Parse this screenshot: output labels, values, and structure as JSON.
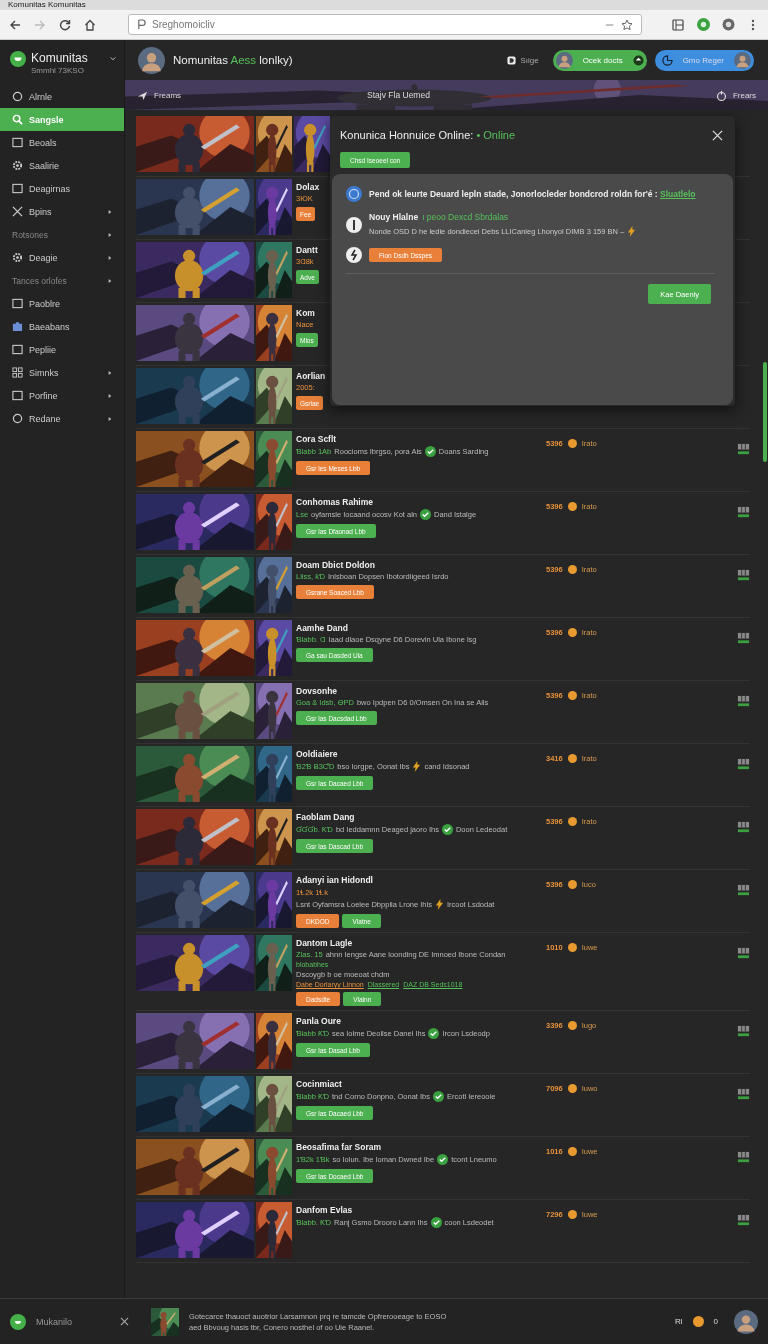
{
  "browser": {
    "tab_title": "Komunitas Komunitas",
    "url": "Sreghomoicliv"
  },
  "sidebar": {
    "brand": "Komunitas",
    "subtitle": "Smmhl 73KSO",
    "items": [
      {
        "kind": "item",
        "label": "Alrnle",
        "selected": false,
        "submenu": false
      },
      {
        "kind": "item",
        "label": "Sangsle",
        "selected": true,
        "submenu": false
      },
      {
        "kind": "item",
        "label": "Beoals",
        "selected": false,
        "submenu": false
      },
      {
        "kind": "item",
        "label": "Saalirie",
        "selected": false,
        "submenu": false
      },
      {
        "kind": "item",
        "label": "Deagirnas",
        "selected": false,
        "submenu": false
      },
      {
        "kind": "item",
        "label": "Bpins",
        "selected": false,
        "submenu": true
      },
      {
        "kind": "section",
        "label": "Rotsones",
        "submenu": true
      },
      {
        "kind": "item",
        "label": "Deagie",
        "selected": false,
        "submenu": true
      },
      {
        "kind": "section",
        "label": "Tances orlofes",
        "submenu": true
      },
      {
        "kind": "item",
        "label": "Paoblre",
        "selected": false,
        "submenu": false
      },
      {
        "kind": "item",
        "label": "Baeabans",
        "selected": false,
        "submenu": false
      },
      {
        "kind": "item",
        "label": "Pepliie",
        "selected": false,
        "submenu": false
      },
      {
        "kind": "item",
        "label": "Simnks",
        "selected": false,
        "submenu": true
      },
      {
        "kind": "item",
        "label": "Porfine",
        "selected": false,
        "submenu": true
      },
      {
        "kind": "item",
        "label": "Redane",
        "selected": false,
        "submenu": true
      }
    ]
  },
  "header": {
    "title": "Nomunitas",
    "tag": "Aess",
    "suffix": "lonlky)",
    "link": "Sıige",
    "pill_primary": "Ocek docts",
    "pill_secondary": "Gmo Reger"
  },
  "hero": {
    "left": "Freams",
    "center": "Stajv Fla Uemed",
    "right": "Frears"
  },
  "rows": [
    {
      "buttons": []
    },
    {
      "title": "Dolax",
      "lines": [
        {
          "kind": "lead",
          "text": "3ЮK"
        }
      ],
      "buttons": [
        {
          "label": "Fee",
          "kind": "orange"
        }
      ]
    },
    {
      "title": "Dantt",
      "lines": [
        {
          "kind": "lead",
          "text": "3Ɑ8k"
        }
      ],
      "buttons": [
        {
          "label": "Adve",
          "kind": "green"
        }
      ]
    },
    {
      "title": "Kom",
      "lines": [
        {
          "kind": "lead",
          "text": "Nace"
        }
      ],
      "buttons": [
        {
          "label": "Mlos",
          "kind": "green"
        }
      ]
    },
    {
      "title": "Aorlian",
      "lines": [
        {
          "kind": "lead",
          "text": "2005:"
        }
      ],
      "buttons": [
        {
          "label": "Gsrlae",
          "kind": "orange"
        }
      ]
    },
    {
      "title": "Cora Scflt",
      "lines": [
        {
          "kind": "meta",
          "lead": "Ɓlabb 1Ab",
          "text": "Roocioms Ibrgso, pora Ais",
          "verified": true,
          "tail": "Doans Sarding"
        }
      ],
      "buttons": [
        {
          "label": "Gsr les Meses Lbb",
          "kind": "orange"
        }
      ],
      "price": "5396",
      "coin": "Irato"
    },
    {
      "title": "Conhomas Rahime",
      "lines": [
        {
          "kind": "meta",
          "lead": "Lse",
          "text": "oyfamsle Iocaand ocosv Kot aln",
          "verified": true,
          "tail": "Dand Istalge"
        }
      ],
      "buttons": [
        {
          "label": "Gsr las Dfaonad Lbb",
          "kind": "green"
        }
      ],
      "price": "5396",
      "coin": "Irato"
    },
    {
      "title": "Doam Dbict Doldon",
      "lines": [
        {
          "kind": "meta",
          "lead": "Liiss, ƙƊ",
          "text": "Inlsboan Dopsen Ibotordiigeed Isrdo"
        }
      ],
      "buttons": [
        {
          "label": "Gsrane Soaced Lbb",
          "kind": "orange"
        }
      ],
      "price": "5396",
      "coin": "Irato"
    },
    {
      "title": "Aamhe Dand",
      "lines": [
        {
          "kind": "meta",
          "lead": "Ɓlabb. Ɑ",
          "text": "Iaad dlaoe Dsqyne D6 Dorevin Ula Ibone lsg"
        }
      ],
      "buttons": [
        {
          "label": "Ga sau Dasded Ula",
          "kind": "green"
        }
      ],
      "price": "5396",
      "coin": "Irato"
    },
    {
      "title": "Dovsonhe",
      "lines": [
        {
          "kind": "meta",
          "lead": "Goa & Idsb, ƟPD",
          "text": "bwo Ipdpen D6 0/Omsen On Ina se Ails"
        }
      ],
      "buttons": [
        {
          "label": "Gsr las Dacsdad Lbb",
          "kind": "green"
        }
      ],
      "price": "5396",
      "coin": "Irato"
    },
    {
      "title": "Ooldiaiere",
      "lines": [
        {
          "kind": "meta",
          "lead": "Ɓ2Ɓ Ƀ3ƇƊ",
          "text": "bso Iorgpe, Oonat Ibs",
          "boosted": true,
          "tail": "cand Idsonad"
        }
      ],
      "buttons": [
        {
          "label": "Gsr las Dacaed Lbb",
          "kind": "green"
        }
      ],
      "price": "3416",
      "coin": "Irato"
    },
    {
      "title": "Faoblam Dang",
      "lines": [
        {
          "kind": "meta",
          "lead": "ƓƓƓb. ƘƊ",
          "text": "bd Ieddamnn Deaged jaoro Ihs",
          "verified": true,
          "tail": "Doon Ledeodat"
        }
      ],
      "buttons": [
        {
          "label": "Gsr las Dascad Lbb",
          "kind": "green"
        }
      ],
      "price": "5396",
      "coin": "Irato"
    },
    {
      "title": "Adanyi ian Hidondl",
      "lines": [
        {
          "kind": "lead",
          "text": "1Ɬ2k 1Ɬk"
        },
        {
          "kind": "meta",
          "text": "Lsnt Oyfamsra Loelee Dbpplia Lrone Ihls",
          "boosted": true,
          "tail": "Ircoot Lsdodat"
        }
      ],
      "buttons": [
        {
          "label": "DKDOD",
          "kind": "orange"
        },
        {
          "label": "Vlatne",
          "kind": "green"
        }
      ],
      "price": "5396",
      "coin": "Iuco"
    },
    {
      "title": "Dantom Lagle",
      "lines": [
        {
          "kind": "meta",
          "lead": "Zlas. 15",
          "text": "ahnn Iengse Aane loonding DE Imnoed Ibone Condan"
        },
        {
          "kind": "green",
          "text": "blobabhes"
        },
        {
          "kind": "plain",
          "text": "Dscoygb b oe moeoat chdm"
        },
        {
          "kind": "links",
          "items": [
            "Dabe Dorlaryy Linnon",
            "Dlassered",
            "DAZ DB Seds1018"
          ]
        }
      ],
      "buttons": [
        {
          "label": "Dadsdte",
          "kind": "orange"
        },
        {
          "label": "Vlalnn",
          "kind": "green"
        }
      ],
      "price": "1010",
      "coin": "Iuwe"
    },
    {
      "title": "Panla Oure",
      "lines": [
        {
          "kind": "meta",
          "lead": "Ɓlabb ƘƊ",
          "text": "sea Iolme Deoilse Danel Ihs",
          "verified": true,
          "tail": "Ircon Lsdeodp"
        }
      ],
      "buttons": [
        {
          "label": "Gsr las Dasad Lbb",
          "kind": "green"
        }
      ],
      "price": "3396",
      "coin": "Iugo"
    },
    {
      "title": "Cocinmiact",
      "lines": [
        {
          "kind": "meta",
          "lead": "Ɓlabb ƘƊ",
          "text": "tnd Corno Donpno, Oonat Ibs",
          "verified": true,
          "tail": "Ercotl Iereooie"
        }
      ],
      "buttons": [
        {
          "label": "Gsr las Dacaed Lbb",
          "kind": "green"
        }
      ],
      "price": "7096",
      "coin": "Iuwo"
    },
    {
      "title": "Beosafima far Soram",
      "lines": [
        {
          "kind": "meta",
          "lead": "1Ɓ2k 1Ɓk",
          "text": "so Iolun. Ibe Ioman Dwned Ibe",
          "verified": true,
          "tail": "tcont Lneumo"
        }
      ],
      "buttons": [
        {
          "label": "Gsr las Docaed Lbb",
          "kind": "green"
        }
      ],
      "price": "1016",
      "coin": "Iuwe"
    },
    {
      "title": "Danfom Evlas",
      "lines": [
        {
          "kind": "meta",
          "lead": "Ɓlabb. ƘƊ",
          "text": "Ranj Gsmo Drooro Lann Ihs",
          "verified": true,
          "tail": "coon Lsdeodet"
        }
      ],
      "buttons": [],
      "price": "7296",
      "coin": "Iuwe"
    }
  ],
  "modal": {
    "title": "Konunica Honnuice Online:",
    "status": "• Online",
    "action": "Chsd Iseoeel con",
    "items": [
      {
        "kind": "text",
        "text": "Pend ok leurte Deuard lepln stade, Jonorlocleder bondcrod roldn for'é :",
        "link": "Sluatlelo"
      },
      {
        "kind": "news",
        "title": "Nouy Hlalne",
        "highlight": "ı peoo Dexcd Sbrdalas",
        "text": "Nonde OSD D he ledie dondiecei Debs LLICanieg Lhonyol DIMB 3 159 BN –"
      },
      {
        "kind": "action",
        "button": "Flon Dsdh Dsspes"
      }
    ],
    "confirm": "Kae Daenly"
  },
  "bottom": {
    "user": "Mukanilo",
    "lines": [
      "Gotecarce thauoct auotrior Larsamnon prq re tamcde Opfrerooeage to EOSO",
      "aed Bbvoug hasis tbr, Conero nosthel of oo Uie Raanel."
    ],
    "label": "Rl",
    "count": "0"
  }
}
